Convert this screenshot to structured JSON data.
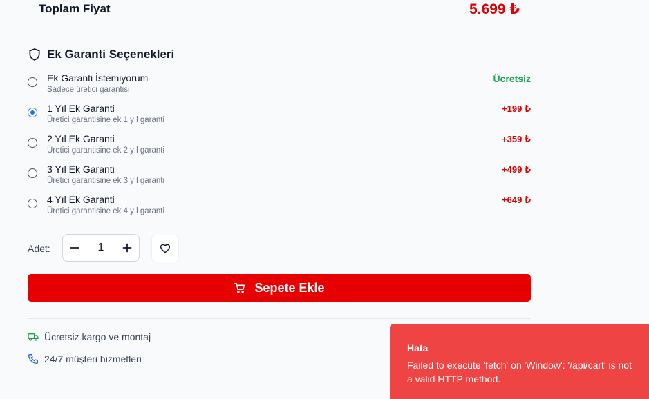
{
  "total": {
    "label": "Toplam Fiyat",
    "value": "5.699 ₺"
  },
  "warranty": {
    "title": "Ek Garanti Seçenekleri",
    "icon": "shield-icon",
    "selected_index": 1,
    "options": [
      {
        "title": "Ek Garanti İstemiyorum",
        "subtitle": "Sadece üretici garantisi",
        "price": "Ücretsiz",
        "selected": false
      },
      {
        "title": "1 Yıl Ek Garanti",
        "subtitle": "Üretici garantisine ek 1 yıl garanti",
        "price": "+199 ₺",
        "selected": true
      },
      {
        "title": "2 Yıl Ek Garanti",
        "subtitle": "Üretici garantisine ek 2 yıl garanti",
        "price": "+359 ₺",
        "selected": false
      },
      {
        "title": "3 Yıl Ek Garanti",
        "subtitle": "Üretici garantisine ek 3 yıl garanti",
        "price": "+499 ₺",
        "selected": false
      },
      {
        "title": "4 Yıl Ek Garanti",
        "subtitle": "Üretici garantisine ek 4 yıl garanti",
        "price": "+649 ₺",
        "selected": false
      }
    ]
  },
  "quantity": {
    "label": "Adet:",
    "value": "1"
  },
  "add_to_cart": {
    "label": "Sepete Ekle",
    "icon": "cart-icon"
  },
  "features": [
    {
      "icon": "truck-icon",
      "text": "Ücretsiz kargo ve montaj"
    },
    {
      "icon": "phone-icon",
      "text": "24/7 müşteri hizmetleri"
    }
  ],
  "toast": {
    "title": "Hata",
    "message": "Failed to execute 'fetch' on 'Window': '/api/cart' is not a valid HTTP method."
  },
  "colors": {
    "price_red": "#dc0000",
    "free_green": "#16a34a",
    "button_red": "#e60000",
    "toast_red": "#ef4444",
    "radio_blue": "#1a73e8"
  }
}
